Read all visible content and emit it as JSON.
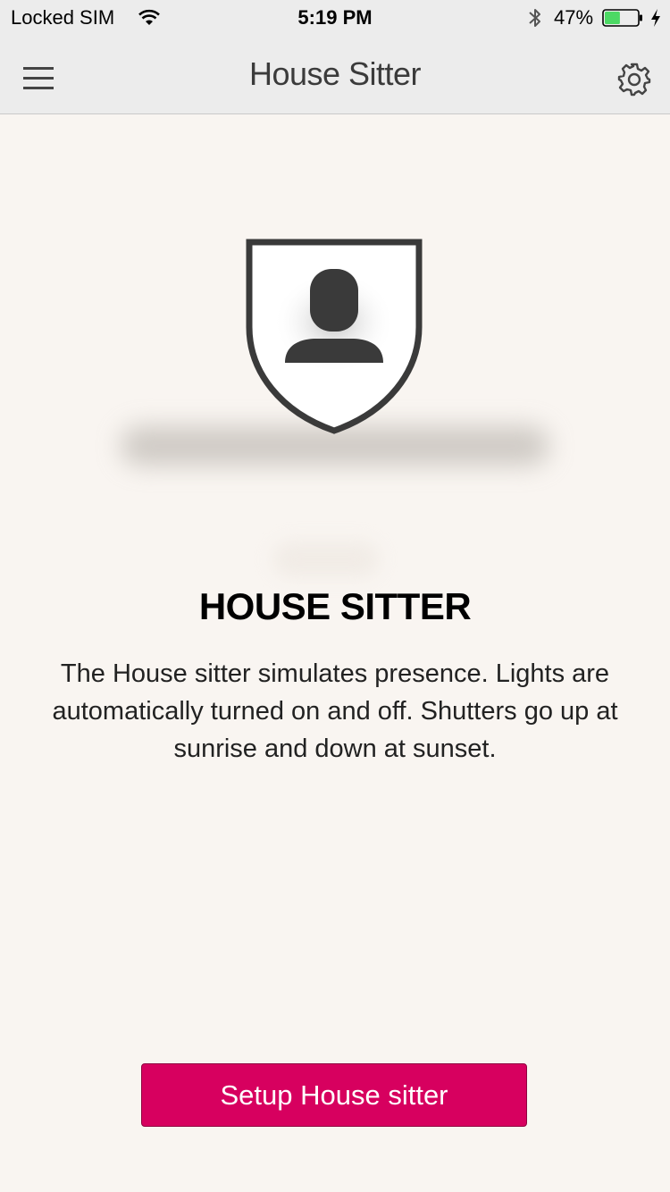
{
  "status_bar": {
    "carrier": "Locked SIM",
    "time": "5:19 PM",
    "battery_percent": "47%",
    "battery_level": 0.47,
    "icons": [
      "wifi-icon",
      "bluetooth-icon",
      "battery-icon",
      "charging-icon"
    ]
  },
  "nav_bar": {
    "title": "House Sitter",
    "menu_icon": "hamburger-menu-icon",
    "settings_icon": "gear-icon"
  },
  "hero": {
    "icon": "shield-person-icon"
  },
  "content": {
    "heading": "HOUSE SITTER",
    "description": "The House sitter simulates presence. Lights are automatically turned on and off. Shutters go up at sunrise and down at sunset."
  },
  "actions": {
    "setup_label": "Setup House sitter"
  },
  "colors": {
    "accent": "#d7005f",
    "background": "#f9f5f1",
    "bar_background": "#ececec",
    "battery_fill": "#4cd964"
  }
}
